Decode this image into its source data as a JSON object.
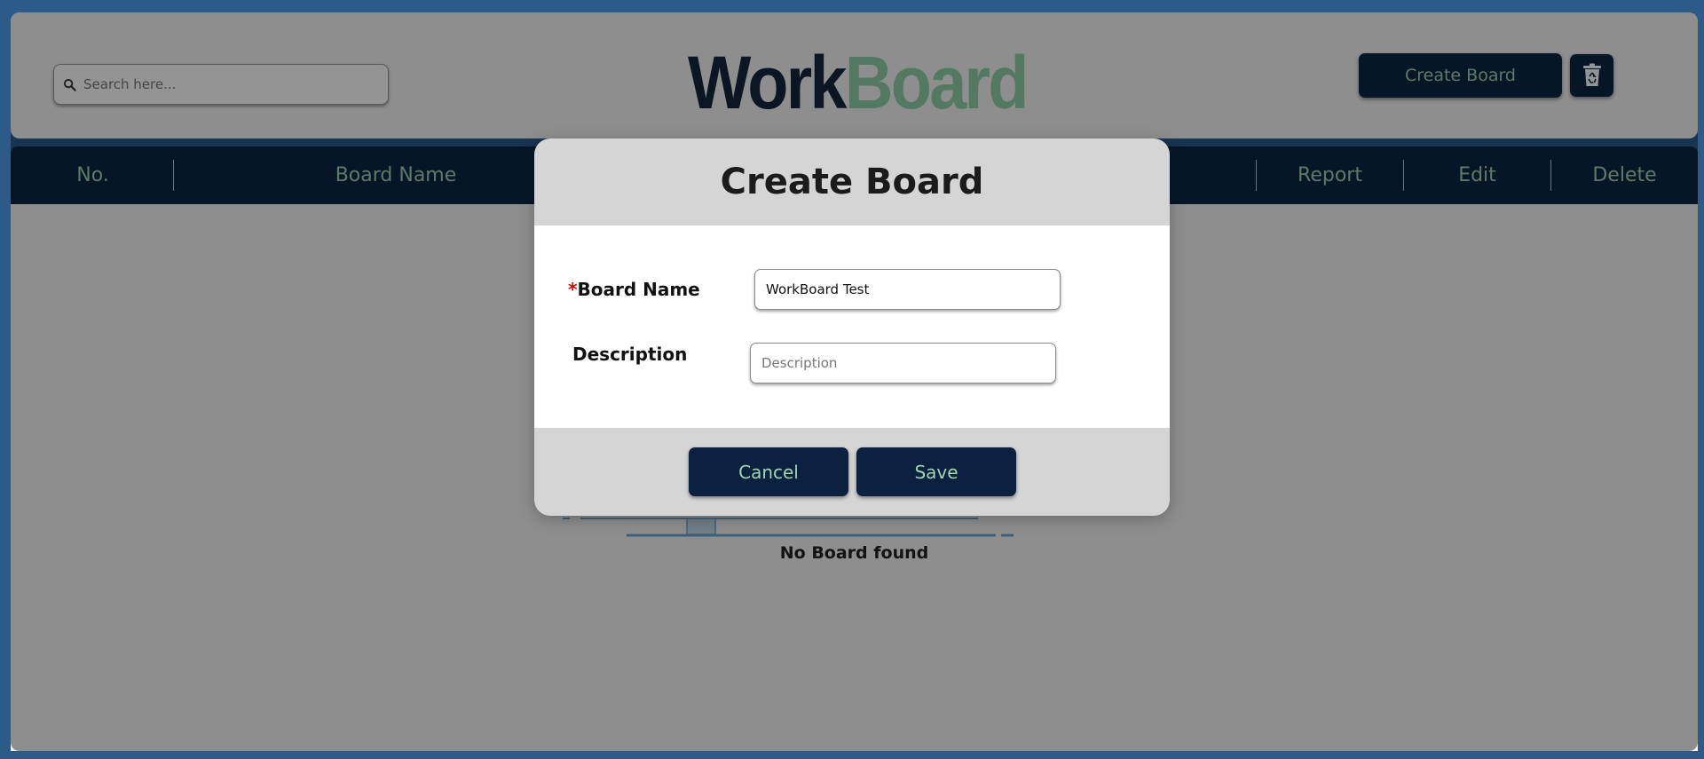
{
  "header": {
    "search_placeholder": "Search here...",
    "logo_part1": "Work",
    "logo_part2": "Board",
    "create_board_label": "Create Board"
  },
  "table": {
    "columns": [
      "No.",
      "Board Name",
      "Report",
      "Edit",
      "Delete"
    ]
  },
  "empty_state": {
    "message": "No Board found"
  },
  "modal": {
    "title": "Create Board",
    "required_marker": "*",
    "board_name_label": "Board Name",
    "board_name_value": "WorkBoard Test",
    "description_label": "Description",
    "description_placeholder": "Description",
    "cancel_label": "Cancel",
    "save_label": "Save"
  },
  "colors": {
    "navy": "#0d2744",
    "mint": "#9ed4b4",
    "required_red": "#d30000"
  }
}
